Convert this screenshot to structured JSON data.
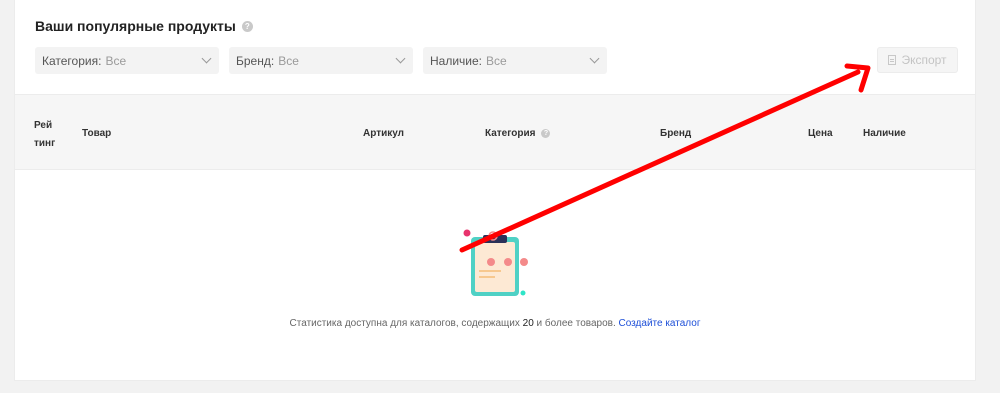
{
  "section": {
    "title": "Ваши популярные продукты",
    "help_glyph": "?"
  },
  "filters": [
    {
      "label": "Категория:",
      "value": "Все"
    },
    {
      "label": "Бренд:",
      "value": "Все"
    },
    {
      "label": "Наличие:",
      "value": "Все"
    }
  ],
  "export_button": {
    "label": "Экспорт",
    "icon": "document-icon",
    "state": "disabled"
  },
  "table": {
    "columns": {
      "rating": "Рейтинг",
      "product": "Товар",
      "article": "Артикул",
      "category": "Категория",
      "brand": "Бренд",
      "price": "Цена",
      "stock": "Наличие"
    }
  },
  "empty_state": {
    "text_before": "Статистика доступна для каталогов, содержащих ",
    "count": "20",
    "text_after": " и более товаров. ",
    "link": "Создайте каталог"
  },
  "colors": {
    "annotation_arrow": "#ff0000",
    "link": "#1d4fd8",
    "illustration_teal": "#4fd1c5",
    "illustration_pink": "#f48a8a"
  }
}
